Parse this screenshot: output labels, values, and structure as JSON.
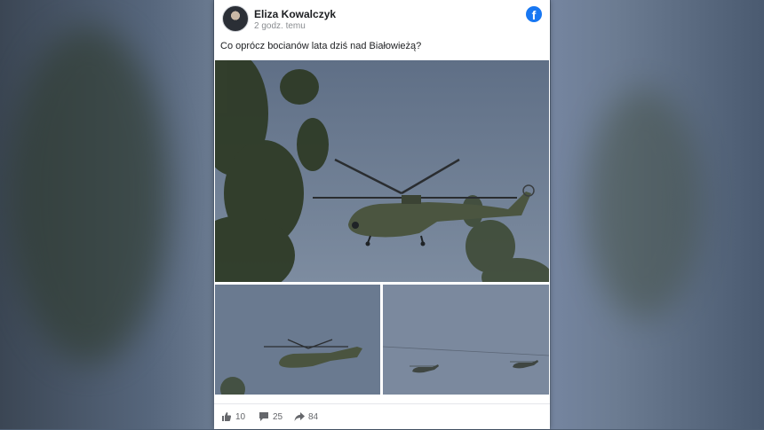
{
  "post": {
    "author": "Eliza Kowalczyk",
    "time": "2 godz. temu",
    "text": "Co oprócz bocianów lata dziś nad Białowieżą?",
    "platform_icon": "f"
  },
  "stats": {
    "likes": "10",
    "comments": "25",
    "shares": "84"
  },
  "colors": {
    "facebook_blue": "#1877f2",
    "sky": "#6e7d92"
  }
}
